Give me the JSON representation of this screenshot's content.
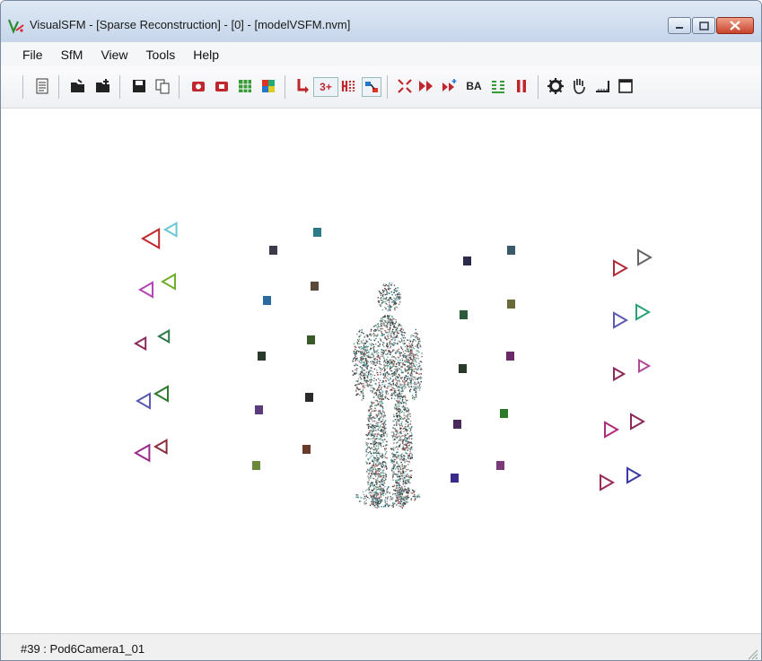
{
  "window": {
    "title": "VisualSFM - [Sparse Reconstruction] - [0] - [modelVSFM.nvm]",
    "controls": [
      "minimize",
      "maximize",
      "close"
    ]
  },
  "menubar": {
    "items": [
      "File",
      "SfM",
      "View",
      "Tools",
      "Help"
    ]
  },
  "toolbar": {
    "text_buttons": {
      "three_plus": "3+",
      "ba": "BA"
    },
    "icons": [
      "document-icon",
      "open-folder-icon",
      "open-folder-plus-icon",
      "save-icon",
      "copy-icon",
      "red-camera-icon",
      "red-camera-alt-icon",
      "grid-match-icon",
      "color-grid-icon",
      "red-arrow-down-icon",
      "three-plus-icon",
      "missing-match-icon",
      "pair-match-icon",
      "expand-icon",
      "forward-arrows-icon",
      "forward-plus-icon",
      "ba-icon",
      "grid-small-icon",
      "pause-icon",
      "gear-icon",
      "hand-icon",
      "ruler-icon",
      "window-icon"
    ]
  },
  "viewport": {
    "description_hidden": false
  },
  "status": {
    "text": "#39 : Pod6Camera1_01"
  },
  "colors": {
    "titlebar": "#c6d6ea",
    "close_button": "#c8432b",
    "red_icon": "#c0272d"
  }
}
